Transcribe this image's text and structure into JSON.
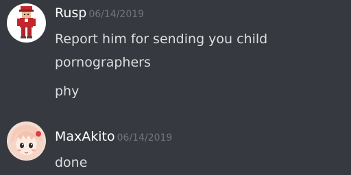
{
  "colors": {
    "background": "#36393f",
    "username": "#ffffff",
    "timestamp": "#72767d",
    "message_text": "#dcddde"
  },
  "messages": [
    {
      "author": "Rusp",
      "timestamp": "06/14/2019",
      "avatar_icon": "red-cap-character-avatar",
      "lines": [
        "Report him for sending you child pornographers",
        "phy"
      ]
    },
    {
      "author": "MaxAkito",
      "timestamp": "06/14/2019",
      "avatar_icon": "anime-girl-avatar",
      "lines": [
        "done"
      ]
    }
  ]
}
